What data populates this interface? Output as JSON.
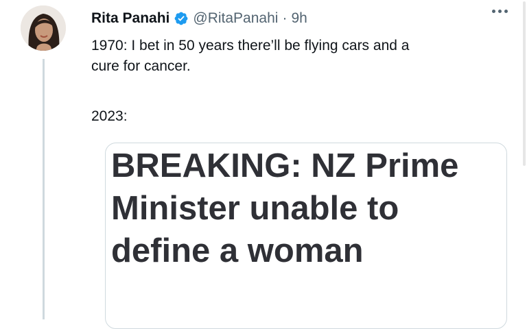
{
  "author": {
    "display_name": "Rita Panahi",
    "handle": "@RitaPanahi",
    "separator": "·",
    "time": "9h",
    "verified": true
  },
  "tweet": {
    "line1": "1970: I bet in 50 years there’ll be flying cars and a",
    "line2": "cure for cancer.",
    "line3": "2023:"
  },
  "card": {
    "headline": "BREAKING: NZ Prime Minister unable to define a woman"
  },
  "colors": {
    "verified_badge": "#1d9bf0",
    "text": "#0f1419",
    "secondary_text": "#536471",
    "border": "#cfd9de"
  }
}
